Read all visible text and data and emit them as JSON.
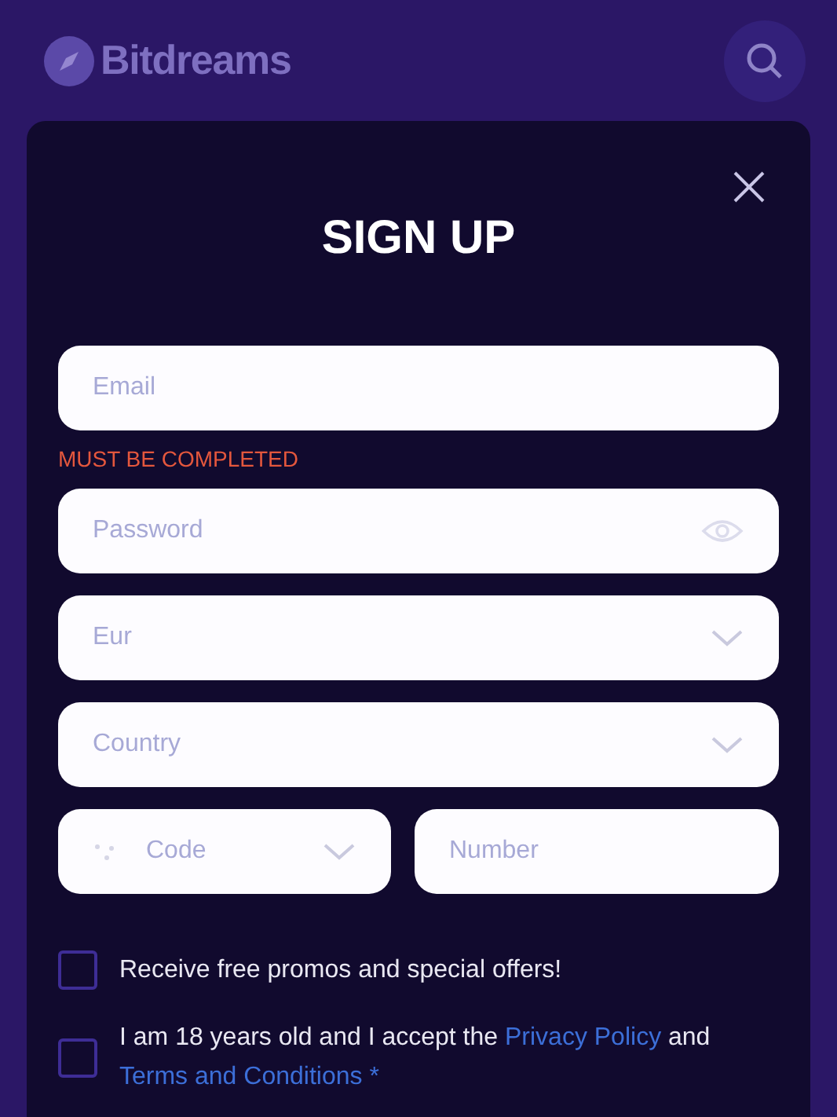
{
  "header": {
    "brand": "Bitdreams"
  },
  "modal": {
    "title": "SIGN UP",
    "fields": [
      {
        "kind": "text",
        "placeholder": "Email",
        "error": "MUST BE COMPLETED"
      },
      {
        "kind": "password",
        "placeholder": "Password"
      },
      {
        "kind": "select",
        "placeholder": "Eur"
      },
      {
        "kind": "select",
        "placeholder": "Country"
      }
    ],
    "phone": {
      "code_placeholder": "Code",
      "number_placeholder": "Number"
    },
    "consents": [
      {
        "checked": false,
        "parts": [
          {
            "kind": "text",
            "text": "Receive free promos and special offers!"
          }
        ]
      },
      {
        "checked": false,
        "parts": [
          {
            "kind": "text",
            "text": "I am 18 years old and I accept the "
          },
          {
            "kind": "link",
            "text": "Privacy Policy"
          },
          {
            "kind": "text",
            "text": " and "
          },
          {
            "kind": "link",
            "text": "Terms and Conditions"
          },
          {
            "kind": "link",
            "text": " *"
          }
        ]
      }
    ]
  }
}
